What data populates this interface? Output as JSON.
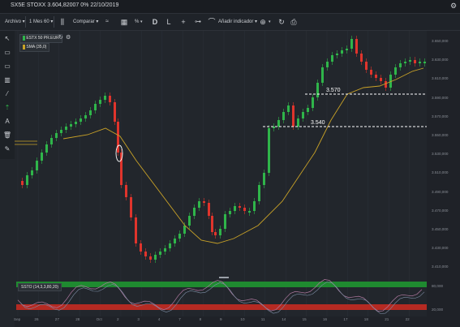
{
  "window": {
    "title": "SX5E STOXX 3.604,82007 0% 22/10/2019"
  },
  "toolbar": {
    "archivo": "Archivo ▾",
    "interval": "1 Mes 60 ▾",
    "compare": "Comparar ▾",
    "pct": "%",
    "d": "D",
    "l": "L",
    "add_indicator": "Añadir indicador ▾"
  },
  "legend": {
    "main": "ESTX 50 PR.EUR",
    "sma": "SMA (35,0)"
  },
  "oscillator": {
    "label": "SSTO (14,3,3,80,20)"
  },
  "price_labels": [
    "3.650,000",
    "3.630,000",
    "3.610,000",
    "3.590,000",
    "3.570,000",
    "3.550,000",
    "3.530,000",
    "3.510,000",
    "3.490,000",
    "3.470,000",
    "3.450,000",
    "3.430,000",
    "3.410,000"
  ],
  "osc_labels": [
    "80,000",
    "20,000"
  ],
  "x_labels": [
    "Sep",
    "26",
    "27",
    "28",
    "Oct",
    "2",
    "3",
    "4",
    "7",
    "8",
    "9",
    "10",
    "11",
    "14",
    "15",
    "16",
    "17",
    "18",
    "21",
    "22"
  ],
  "hlines": [
    {
      "label": "3.570"
    },
    {
      "label": "3.540"
    }
  ],
  "colors": {
    "up": "#2fb54a",
    "down": "#e0342c",
    "sma": "#c9a227",
    "bg": "#22262c"
  }
}
